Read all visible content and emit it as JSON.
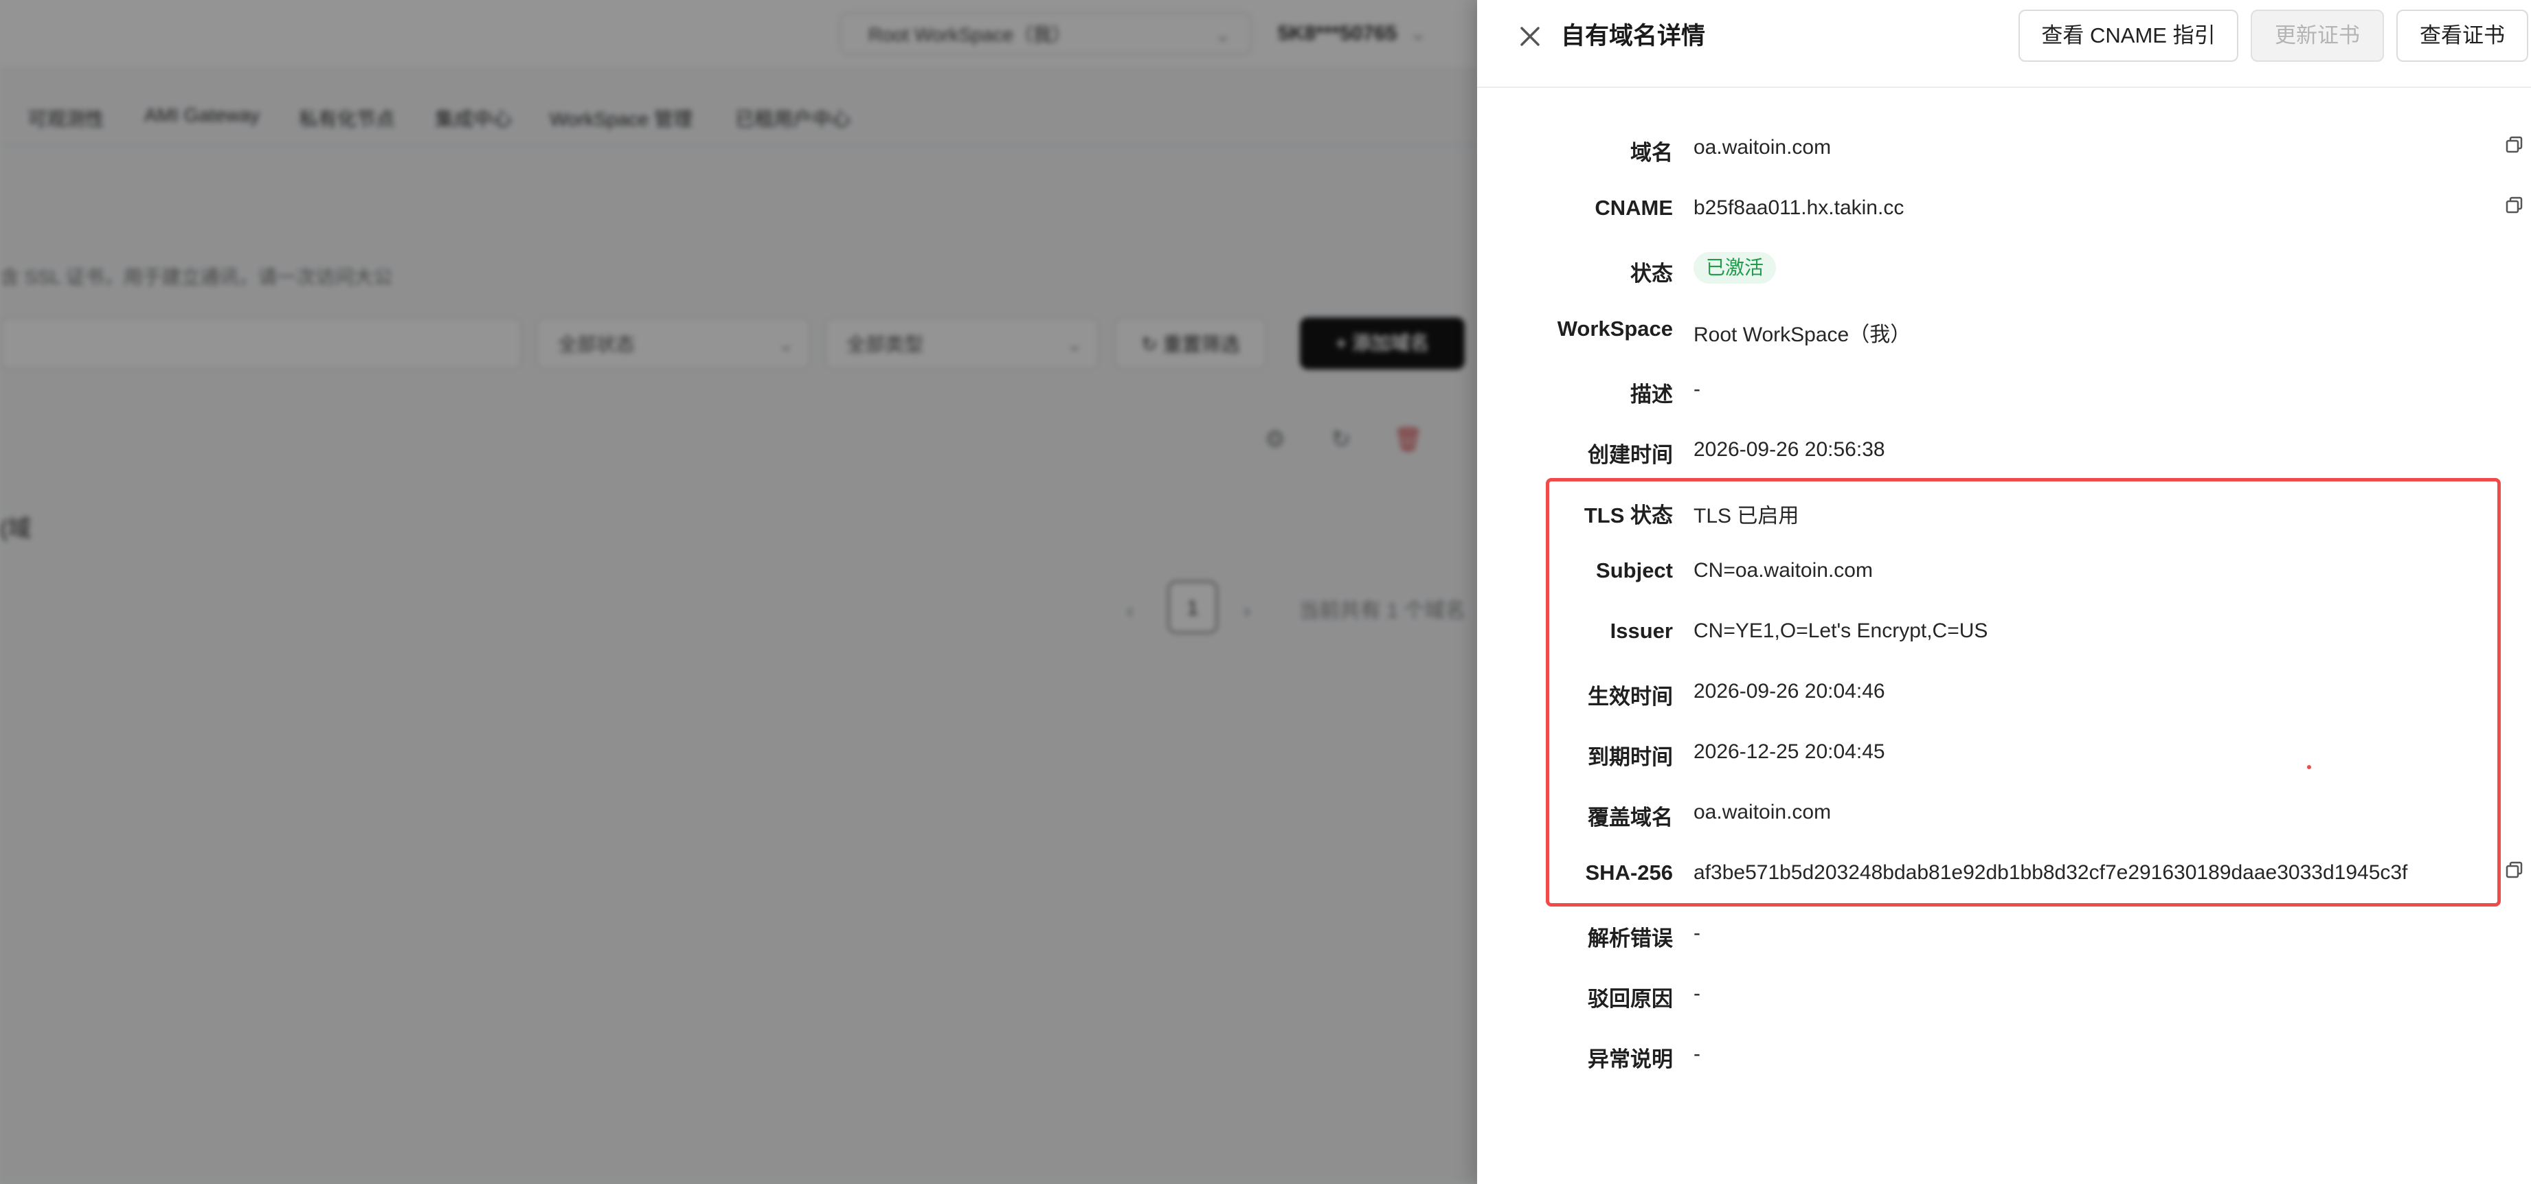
{
  "background": {
    "workspace_select": "Root WorkSpace（我）",
    "user_account": "5K8***50765",
    "nav_items": [
      "可观测性",
      "AMI Gateway",
      "私有化节点",
      "集成中心",
      "WorkSpace 管理",
      "已租用户中心"
    ],
    "page_description": "含 SSL 证书，用于建立通讯，请一次访问大公",
    "filter_status_placeholder": "全部状态",
    "filter_type_placeholder": "全部类型",
    "reset_label": "重置筛选",
    "add_label": "添加域名",
    "side_text": "(域",
    "pager_current": "1",
    "pager_total": "当前共有 1 个域名"
  },
  "drawer": {
    "title": "自有域名详情",
    "buttons": {
      "view_cname_guide": "查看 CNAME 指引",
      "renew_cert": "更新证书",
      "view_cert": "查看证书"
    },
    "rows": [
      {
        "label": "域名",
        "value": "oa.waitoin.com"
      },
      {
        "label": "CNAME",
        "value": "b25f8aa011.hx.takin.cc"
      },
      {
        "label": "状态",
        "value": "已激活"
      },
      {
        "label": "WorkSpace",
        "value": "Root WorkSpace（我）"
      },
      {
        "label": "描述",
        "value": "-"
      },
      {
        "label": "创建时间",
        "value": "2026-09-26 20:56:38"
      },
      {
        "label": "TLS 状态",
        "value": "TLS 已启用"
      },
      {
        "label": "Subject",
        "value": "CN=oa.waitoin.com"
      },
      {
        "label": "Issuer",
        "value": "CN=YE1,O=Let's Encrypt,C=US"
      },
      {
        "label": "生效时间",
        "value": "2026-09-26 20:04:46"
      },
      {
        "label": "到期时间",
        "value": "2026-12-25 20:04:45"
      },
      {
        "label": "覆盖域名",
        "value": "oa.waitoin.com"
      },
      {
        "label": "SHA-256",
        "value": "af3be571b5d203248bdab81e92db1bb8d32cf7e291630189daae3033d1945c3f"
      },
      {
        "label": "解析错误",
        "value": "-"
      },
      {
        "label": "驳回原因",
        "value": "-"
      },
      {
        "label": "异常说明",
        "value": "-"
      }
    ]
  },
  "colors": {
    "highlight": "#ef4b4b",
    "status_active_bg": "#e9f7ee",
    "status_active_text": "#1f9b4a",
    "primary_dark": "#141414"
  }
}
